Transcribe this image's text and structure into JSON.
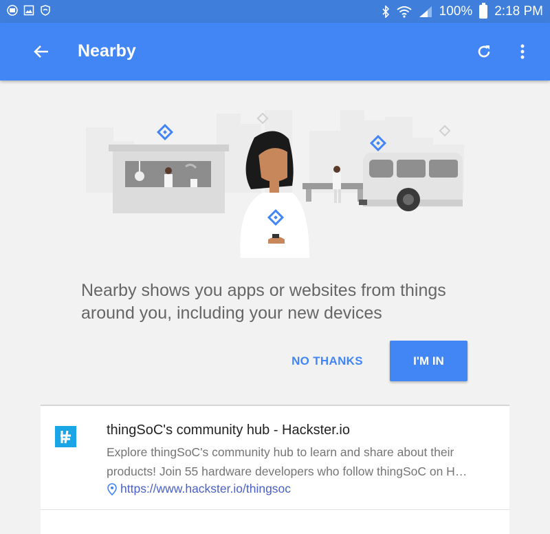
{
  "status_bar": {
    "battery_percent": "100%",
    "time": "2:18 PM",
    "left_icons": [
      "chat-icon",
      "image-icon",
      "shield-icon"
    ],
    "right_icons": [
      "bluetooth-icon",
      "wifi-icon",
      "signal-icon",
      "battery-icon"
    ]
  },
  "app_bar": {
    "title": "Nearby",
    "color": "#4285f4",
    "icons": [
      "back-arrow-icon",
      "refresh-icon",
      "more-vert-icon"
    ]
  },
  "intro": {
    "text": "Nearby shows you apps or websites from things around you, including your new devices",
    "no_thanks_label": "NO THANKS",
    "im_in_label": "I'M IN"
  },
  "results": [
    {
      "title": "thingSoC's community hub - Hackster.io",
      "description": "Explore thingSoC's community hub to learn and share about their products! Join 55 hardware developers who follow thingSoC on H…",
      "url": "https://www.hackster.io/thingsoc",
      "icon": "hackster-logo-icon"
    }
  ]
}
